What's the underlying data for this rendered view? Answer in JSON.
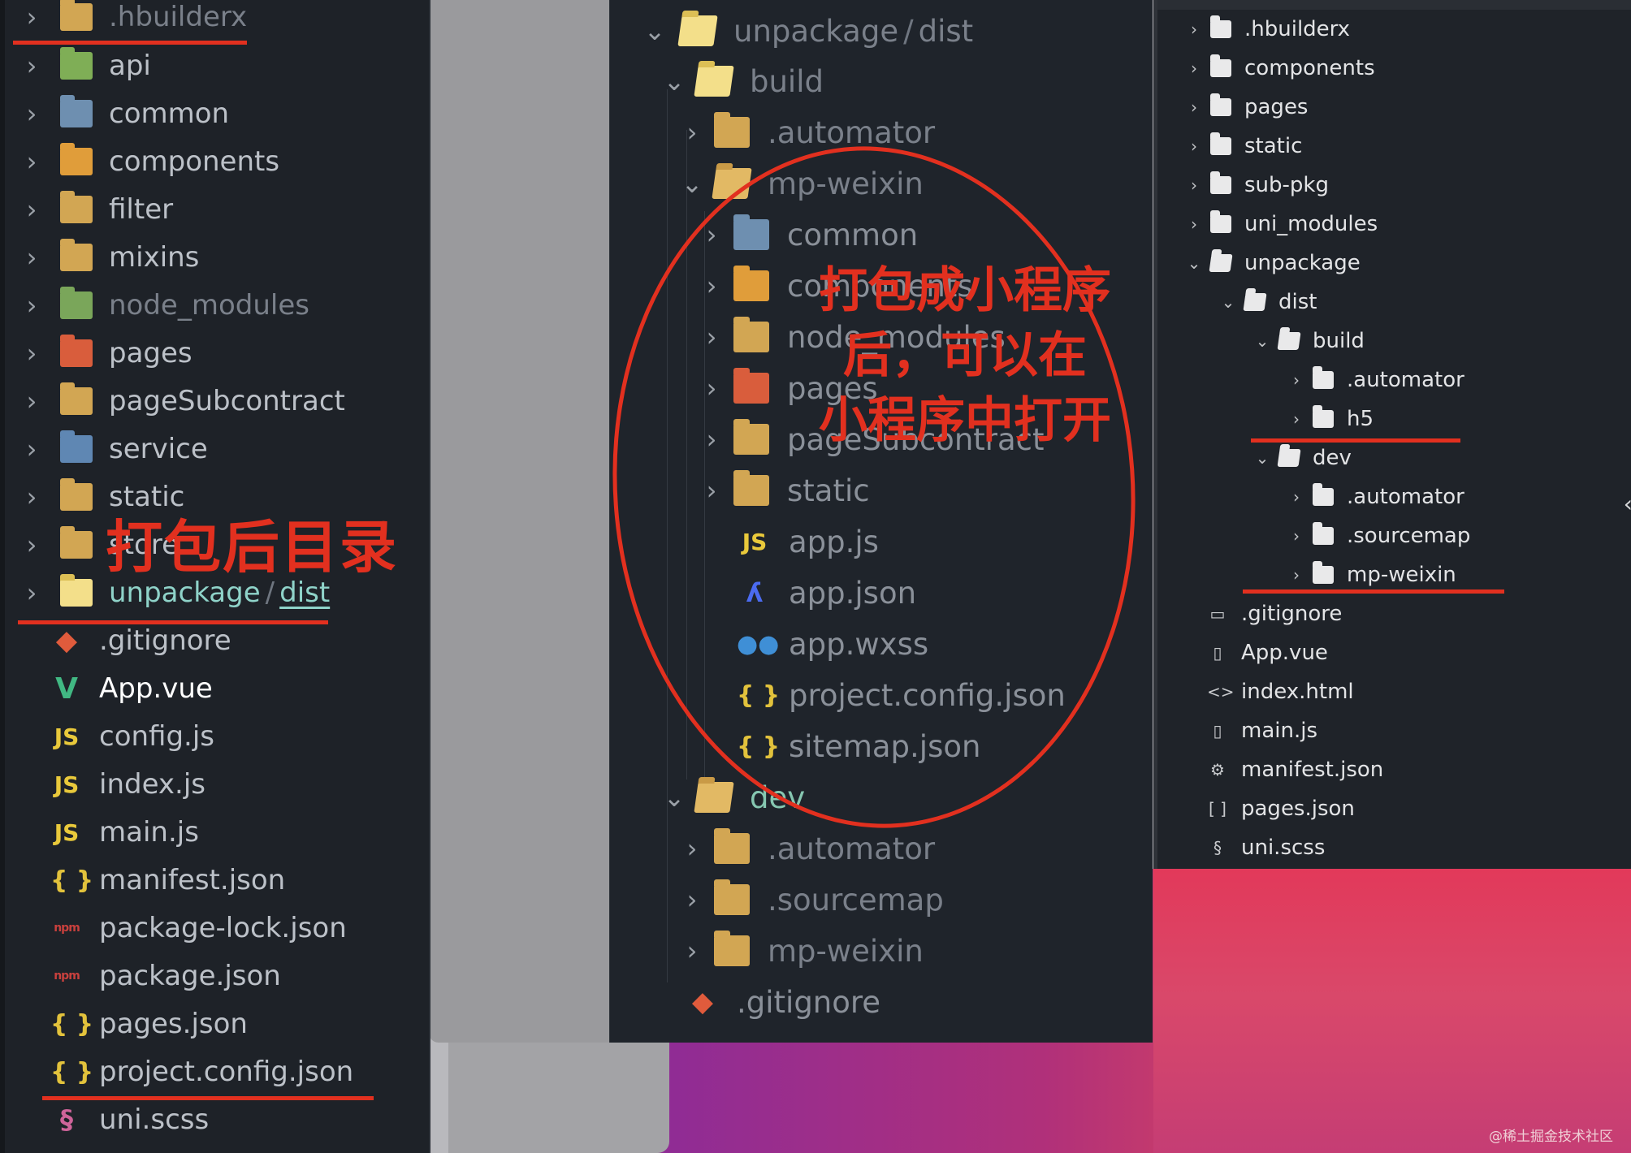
{
  "left_panel": {
    "items": [
      {
        "name": ".hbuilderx",
        "icon": "folder-icon",
        "chevron": true,
        "style": "dim"
      },
      {
        "name": "api",
        "icon": "folder-api-icon",
        "chevron": true
      },
      {
        "name": "common",
        "icon": "folder-common-icon",
        "chevron": true
      },
      {
        "name": "components",
        "icon": "folder-components-icon",
        "chevron": true
      },
      {
        "name": "filter",
        "icon": "folder-icon",
        "chevron": true
      },
      {
        "name": "mixins",
        "icon": "folder-icon",
        "chevron": true
      },
      {
        "name": "node_modules",
        "icon": "folder-node-icon",
        "chevron": true,
        "style": "dim"
      },
      {
        "name": "pages",
        "icon": "folder-pages-icon",
        "chevron": true
      },
      {
        "name": "pageSubcontract",
        "icon": "folder-icon",
        "chevron": true
      },
      {
        "name": "service",
        "icon": "folder-service-icon",
        "chevron": true
      },
      {
        "name": "static",
        "icon": "folder-icon",
        "chevron": true
      },
      {
        "name": "store",
        "icon": "folder-icon",
        "chevron": true
      },
      {
        "name_a": "unpackage",
        "sep": "/",
        "name_b": "dist",
        "icon": "folder-dist-icon",
        "chevron": true,
        "style": "hl"
      },
      {
        "name": ".gitignore",
        "icon": "git-icon"
      },
      {
        "name": "App.vue",
        "icon": "vue-icon",
        "style": "white"
      },
      {
        "name": "config.js",
        "icon": "js-icon"
      },
      {
        "name": "index.js",
        "icon": "js-icon"
      },
      {
        "name": "main.js",
        "icon": "js-icon"
      },
      {
        "name": "manifest.json",
        "icon": "json-icon"
      },
      {
        "name": "package-lock.json",
        "icon": "npm-icon"
      },
      {
        "name": "package.json",
        "icon": "npm-icon"
      },
      {
        "name": "pages.json",
        "icon": "json-icon"
      },
      {
        "name": "project.config.json",
        "icon": "json-icon"
      },
      {
        "name": "uni.scss",
        "icon": "sass-icon"
      }
    ],
    "annotation": "打包后目录"
  },
  "middle_panel": {
    "root_a": "unpackage",
    "root_sep": "/",
    "root_b": "dist",
    "build": "build",
    "automator": ".automator",
    "mp_weixin": "mp-weixin",
    "children": [
      "common",
      "components",
      "node_modules",
      "pages",
      "pageSubcontract",
      "static"
    ],
    "files": [
      "app.js",
      "app.json",
      "app.wxss",
      "project.config.json",
      "sitemap.json"
    ],
    "dev": "dev",
    "dev_children": [
      ".automator",
      ".sourcemap",
      "mp-weixin"
    ],
    "gitignore": ".gitignore",
    "annotation_lines": [
      "打包成小程序",
      "后，可以在",
      "小程序中打开"
    ]
  },
  "right_panel": {
    "folders": [
      ".hbuilderx",
      "components",
      "pages",
      "static",
      "sub-pkg",
      "uni_modules"
    ],
    "unpackage": "unpackage",
    "dist": "dist",
    "build": "build",
    "build_children": [
      ".automator",
      "h5"
    ],
    "dev": "dev",
    "dev_children": [
      ".automator",
      ".sourcemap",
      "mp-weixin"
    ],
    "files": [
      {
        "name": ".gitignore",
        "icon": "file-icon"
      },
      {
        "name": "App.vue",
        "icon": "vue-file-icon"
      },
      {
        "name": "index.html",
        "icon": "html-icon"
      },
      {
        "name": "main.js",
        "icon": "js-file-icon"
      },
      {
        "name": "manifest.json",
        "icon": "manifest-icon"
      },
      {
        "name": "pages.json",
        "icon": "brackets-icon"
      },
      {
        "name": "uni.scss",
        "icon": "scss-icon"
      }
    ]
  },
  "watermark": "@稀土掘金技术社区",
  "colors": {
    "annotation_red": "#e2301f",
    "folder": "#d2a653",
    "highlight": "#8fd3c9"
  }
}
